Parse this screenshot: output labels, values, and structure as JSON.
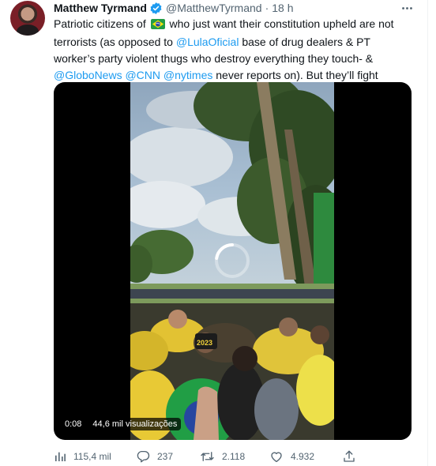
{
  "author": {
    "name": "Matthew Tyrmand",
    "handle": "@MatthewTyrmand",
    "separator": "·",
    "time": "18 h",
    "avatar_icon": "avatar-photo",
    "verified_icon": "verified-badge-icon"
  },
  "more_icon": "more-options-icon",
  "tweet": {
    "part1": "Patriotic citizens of",
    "flag_icon": "brazil-flag-emoji",
    "part2": "who just want their constitution upheld are not terrorists (as opposed to",
    "mention1": "@LulaOficial",
    "part3": "base of drug dealers & PT worker’s party violent thugs who destroy everything they touch- &",
    "mention2": "@GloboNews",
    "mention3": "@CNN",
    "mention4": "@nytimes",
    "part4": "never reports on). But they’ll fight against coup."
  },
  "video": {
    "time": "0:08",
    "views": "44,6 mil visualizações",
    "spinner_icon": "loading-spinner-icon",
    "sign_text": "2023"
  },
  "actions": {
    "views": {
      "icon": "analytics-icon",
      "count": "115,4 mil"
    },
    "replies": {
      "icon": "reply-icon",
      "count": "237"
    },
    "retweets": {
      "icon": "retweet-icon",
      "count": "2.118"
    },
    "likes": {
      "icon": "like-icon",
      "count": "4.932"
    },
    "share": {
      "icon": "share-icon"
    }
  },
  "colors": {
    "link": "#1d9bf0",
    "secondary_text": "#536471",
    "primary_text": "#0f1419",
    "media_background": "#000000"
  }
}
